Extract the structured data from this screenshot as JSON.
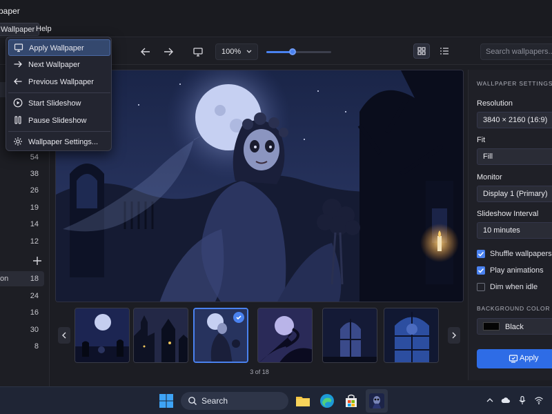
{
  "app": {
    "title": "paper"
  },
  "menubar": {
    "wallpaper": "Wallpaper",
    "help": "Help"
  },
  "toolbar": {
    "zoom": "100%",
    "zoom_level": 0.4,
    "search_placeholder": "Search wallpapers..."
  },
  "menu": {
    "items": [
      {
        "label": "Apply Wallpaper",
        "icon": "monitor-icon"
      },
      {
        "label": "Next Wallpaper",
        "icon": "arrow-right-icon"
      },
      {
        "label": "Previous Wallpaper",
        "icon": "arrow-left-icon"
      },
      {
        "label": "Start Slideshow",
        "icon": "play-icon"
      },
      {
        "label": "Pause Slideshow",
        "icon": "pause-icon"
      },
      {
        "label": "Wallpaper Settings...",
        "icon": "gear-icon"
      }
    ]
  },
  "sidebar": {
    "counts_top": [
      "54",
      "38",
      "26",
      "19",
      "14",
      "12"
    ],
    "selected": {
      "label": "on",
      "count": "18"
    },
    "counts_bottom": [
      "24",
      "16",
      "30",
      "8"
    ]
  },
  "gallery": {
    "counter": "3 of 18",
    "selected_index": 2
  },
  "settings": {
    "header": "WALLPAPER SETTINGS",
    "resolution_label": "Resolution",
    "resolution_value": "3840 × 2160 (16:9)",
    "fit_label": "Fit",
    "fit_value": "Fill",
    "monitor_label": "Monitor",
    "monitor_value": "Display 1 (Primary)",
    "interval_label": "Slideshow Interval",
    "interval_value": "10 minutes",
    "shuffle_label": "Shuffle wallpapers",
    "shuffle_checked": true,
    "animations_label": "Play animations",
    "animations_checked": true,
    "dim_label": "Dim when idle",
    "dim_checked": false,
    "bg_header": "BACKGROUND COLOR",
    "bg_value": "Black",
    "apply_label": "Apply"
  },
  "taskbar": {
    "search_label": "Search"
  },
  "colors": {
    "accent": "#4a82f0",
    "apply": "#2e6ce6",
    "menu_highlight": "#34486e"
  }
}
